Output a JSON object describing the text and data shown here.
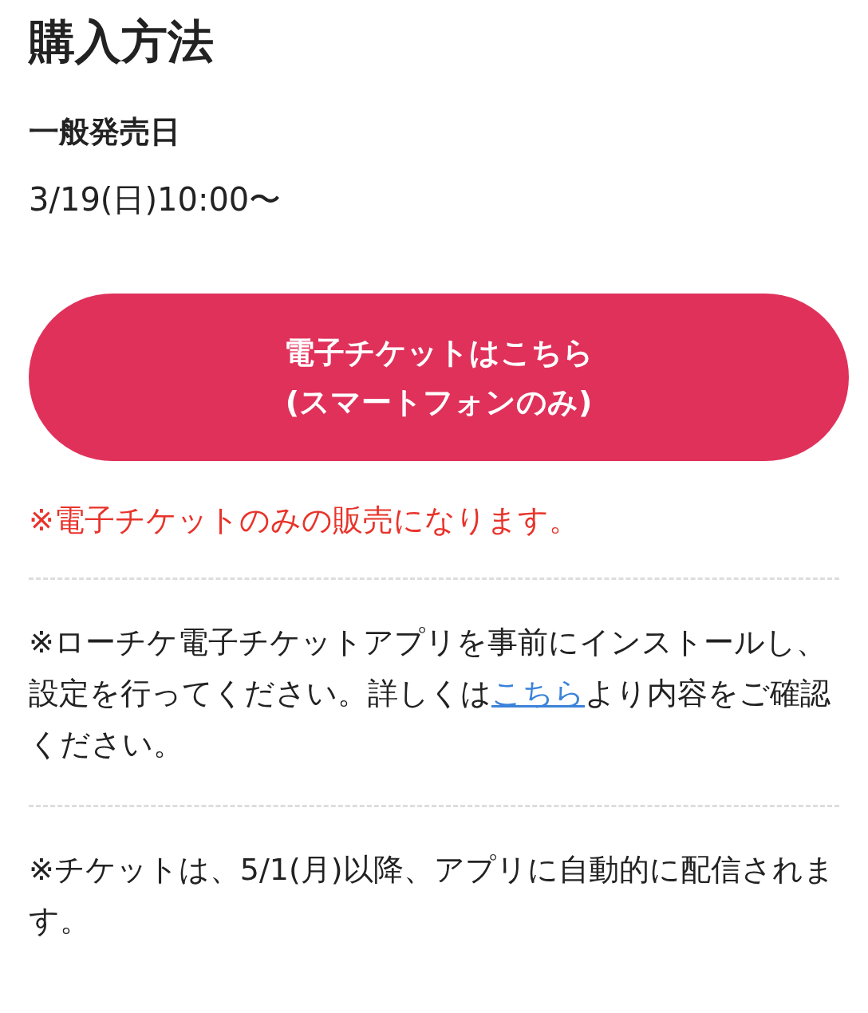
{
  "title": "購入方法",
  "sale": {
    "label": "一般発売日",
    "date": "3/19(日)10:00〜"
  },
  "button": {
    "lines": [
      "電子チケットはこちら",
      "(スマートフォンのみ)"
    ]
  },
  "warning": "※電子チケットのみの販売になります。",
  "notes": [
    {
      "parts": [
        {
          "kind": "text",
          "text": "※ローチケ電子チケットアプリを事前にインストールし、設定を行ってください。詳しくは"
        },
        {
          "kind": "link",
          "text": "こちら"
        },
        {
          "kind": "text",
          "text": "より内容をご確認ください。"
        }
      ]
    },
    {
      "parts": [
        {
          "kind": "text",
          "text": "※チケットは、5/1(月)以降、アプリに自動的に配信されます。"
        }
      ]
    }
  ]
}
